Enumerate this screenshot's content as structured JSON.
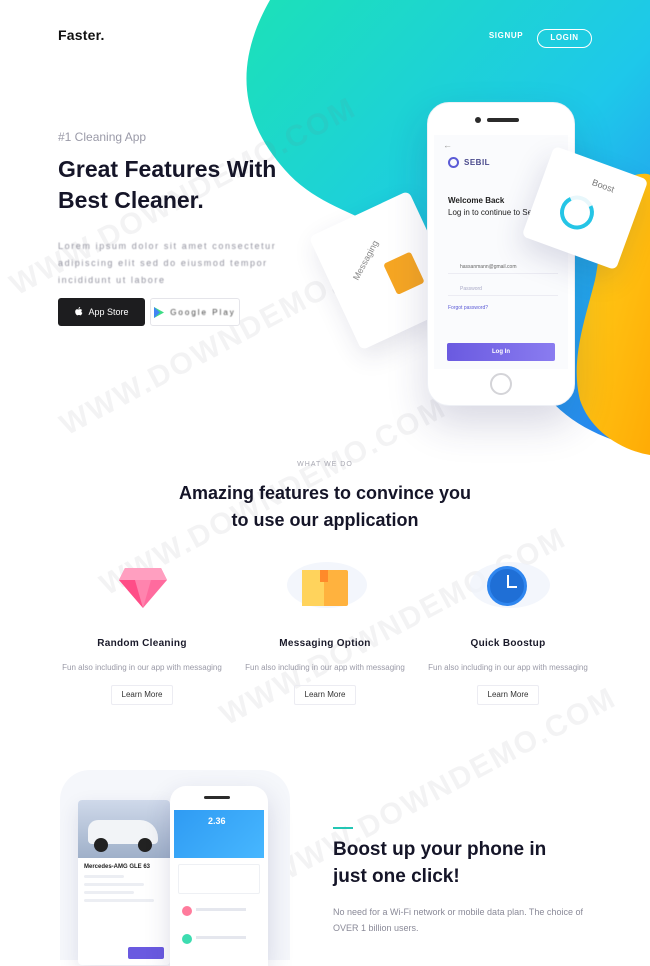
{
  "header": {
    "logo": "Faster.",
    "signup": "SIGNUP",
    "login": "LOGIN"
  },
  "hero": {
    "eyebrow": "#1 Cleaning App",
    "title_line1": "Great Features With",
    "title_line2": "Best Cleaner.",
    "blurred_text": "Lorem ipsum dolor sit amet consectetur adipiscing elit sed do eiusmod tempor incididunt ut labore",
    "appstore_label": "App Store",
    "googleplay_label": "Google Play"
  },
  "mockup": {
    "messaging_label": "Messaging",
    "boost_label": "Boost",
    "brand": "SEBIL",
    "welcome_title": "Welcome Back",
    "welcome_sub": "Log in to continue to Sebil",
    "email": "hassanmann@gmail.com",
    "password_placeholder": "Password",
    "forgot": "Forgot password?",
    "login_button": "Log In"
  },
  "features_section": {
    "eyebrow": "WHAT WE DO",
    "title_line1": "Amazing features to convince you",
    "title_line2": "to use our application",
    "items": [
      {
        "title": "Random Cleaning",
        "desc": "Fun also including in our app with messaging",
        "link": "Learn More",
        "icon": "gem-icon"
      },
      {
        "title": "Messaging Option",
        "desc": "Fun also including in our app with messaging",
        "link": "Learn More",
        "icon": "folder-icon"
      },
      {
        "title": "Quick Boostup",
        "desc": "Fun also including in our app with messaging",
        "link": "Learn More",
        "icon": "clock-icon"
      }
    ]
  },
  "boost_section": {
    "title_line1": "Boost up your phone in",
    "title_line2": "just one click!",
    "desc": "No need for a Wi-Fi network or mobile data plan. The choice of OVER 1 billion users.",
    "car_name": "Mercedes-AMG GLE 63",
    "app_amount": "2.36"
  },
  "watermark": "WWW.DOWNDEMO.COM",
  "colors": {
    "gradient_teal": "#19d8c0",
    "gradient_blue": "#2a8bf2",
    "gradient_yellow": "#ffbe12",
    "button_purple": "#6a5ae0",
    "accent_teal": "#23c6b4"
  }
}
